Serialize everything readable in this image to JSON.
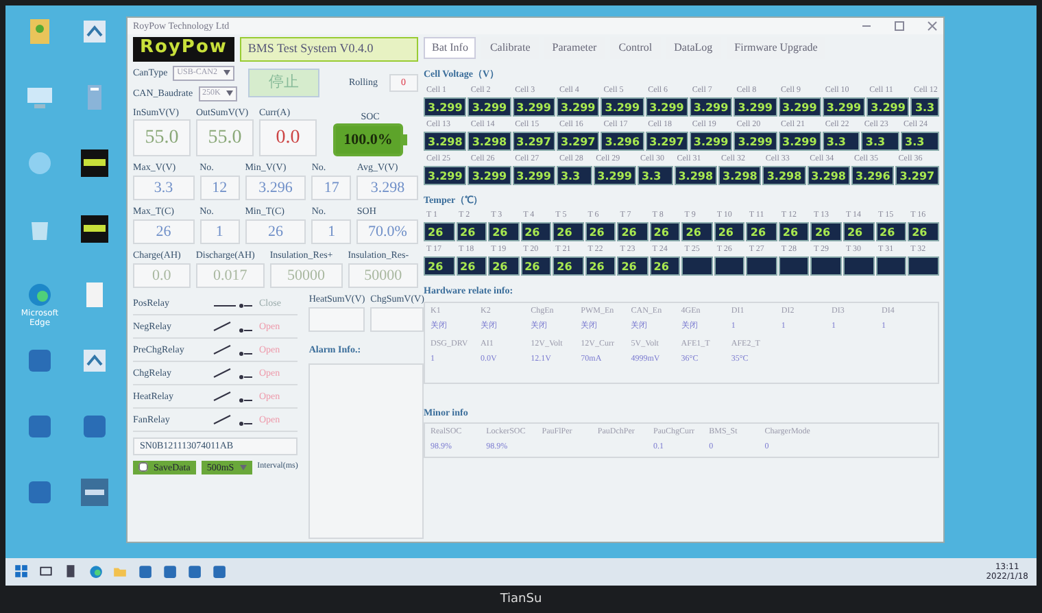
{
  "monitor": {
    "brand": "TianSu"
  },
  "desktop_icons": [
    {
      "kind": "user"
    },
    {
      "kind": "shortcut"
    },
    {
      "kind": "pc"
    },
    {
      "kind": "building"
    },
    {
      "kind": "network"
    },
    {
      "kind": "logo"
    },
    {
      "kind": "bin"
    },
    {
      "kind": "logo"
    },
    {
      "kind": "edge",
      "label": "Microsoft Edge"
    },
    {
      "kind": "doc"
    },
    {
      "kind": "app"
    },
    {
      "kind": "shortcut"
    },
    {
      "kind": "app"
    },
    {
      "kind": "app"
    },
    {
      "kind": "app"
    },
    {
      "kind": "bms"
    }
  ],
  "window": {
    "title": "RoyPow Technology Ltd",
    "logo": "RoyPow",
    "system_title": "BMS Test System V0.4.0"
  },
  "tabs": [
    {
      "label": "Bat Info",
      "selected": true
    },
    {
      "label": "Calibrate",
      "selected": false
    },
    {
      "label": "Parameter",
      "selected": false
    },
    {
      "label": "Control",
      "selected": false
    },
    {
      "label": "DataLog",
      "selected": false
    },
    {
      "label": "Firmware Upgrade",
      "selected": false
    }
  ],
  "connection": {
    "can_type_label": "CanType",
    "can_type": "USB-CAN2",
    "baud_label": "CAN_Baudrate",
    "baud": "250K",
    "stop_button": "停止",
    "rolling_label": "Rolling",
    "rolling": "0"
  },
  "summary": [
    {
      "label": "InSumV(V)",
      "value": "55.0",
      "kind": "voltage"
    },
    {
      "label": "OutSumV(V)",
      "value": "55.0",
      "kind": "voltage"
    },
    {
      "label": "Curr(A)",
      "value": "0.0",
      "kind": "current"
    }
  ],
  "soc": {
    "label": "SOC",
    "value": "100.0%",
    "level": 1.0
  },
  "stats": [
    [
      {
        "label": "Max_V(V)",
        "value": "3.3"
      },
      {
        "label": "No.",
        "value": "12"
      },
      {
        "label": "Min_V(V)",
        "value": "3.296"
      },
      {
        "label": "No.",
        "value": "17"
      },
      {
        "label": "Avg_V(V)",
        "value": "3.298"
      }
    ],
    [
      {
        "label": "Max_T(C)",
        "value": "26"
      },
      {
        "label": "No.",
        "value": "1"
      },
      {
        "label": "Min_T(C)",
        "value": "26"
      },
      {
        "label": "No.",
        "value": "1"
      },
      {
        "label": "SOH",
        "value": "70.0%"
      }
    ]
  ],
  "energy": [
    {
      "label": "Charge(AH)",
      "value": "0.0"
    },
    {
      "label": "Discharge(AH)",
      "value": "0.017"
    },
    {
      "label": "Insulation_Res+",
      "value": "50000"
    },
    {
      "label": "Insulation_Res-",
      "value": "50000"
    }
  ],
  "sums": [
    {
      "label": "HeatSumV(V)"
    },
    {
      "label": "ChgSumV(V)"
    }
  ],
  "relays": [
    {
      "name": "PosRelay",
      "closed": true,
      "state": "Close"
    },
    {
      "name": "NegRelay",
      "closed": false,
      "state": "Open"
    },
    {
      "name": "PreChgRelay",
      "closed": false,
      "state": "Open"
    },
    {
      "name": "ChgRelay",
      "closed": false,
      "state": "Open"
    },
    {
      "name": "HeatRelay",
      "closed": false,
      "state": "Open"
    },
    {
      "name": "FanRelay",
      "closed": false,
      "state": "Open"
    }
  ],
  "alarm": {
    "title": "Alarm Info.:"
  },
  "serial": "SN0B121113074011AB",
  "save": {
    "label": "SaveData",
    "checked": false,
    "interval": "500mS",
    "interval_label": "Interval(ms)"
  },
  "cell_voltage": {
    "title": "Cell Voltage（V）",
    "cells": [
      {
        "label": "Cell 1",
        "value": "3.299"
      },
      {
        "label": "Cell 2",
        "value": "3.299"
      },
      {
        "label": "Cell 3",
        "value": "3.299"
      },
      {
        "label": "Cell 4",
        "value": "3.299"
      },
      {
        "label": "Cell 5",
        "value": "3.299"
      },
      {
        "label": "Cell 6",
        "value": "3.299"
      },
      {
        "label": "Cell 7",
        "value": "3.299"
      },
      {
        "label": "Cell 8",
        "value": "3.299"
      },
      {
        "label": "Cell 9",
        "value": "3.299"
      },
      {
        "label": "Cell 10",
        "value": "3.299"
      },
      {
        "label": "Cell 11",
        "value": "3.299"
      },
      {
        "label": "Cell 12",
        "value": "3.3"
      },
      {
        "label": "Cell 13",
        "value": "3.298"
      },
      {
        "label": "Cell 14",
        "value": "3.298"
      },
      {
        "label": "Cell 15",
        "value": "3.297"
      },
      {
        "label": "Cell 16",
        "value": "3.297"
      },
      {
        "label": "Cell 17",
        "value": "3.296"
      },
      {
        "label": "Cell 18",
        "value": "3.297"
      },
      {
        "label": "Cell 19",
        "value": "3.299"
      },
      {
        "label": "Cell 20",
        "value": "3.299"
      },
      {
        "label": "Cell 21",
        "value": "3.299"
      },
      {
        "label": "Cell 22",
        "value": "3.3"
      },
      {
        "label": "Cell 23",
        "value": "3.3"
      },
      {
        "label": "Cell 24",
        "value": "3.3"
      },
      {
        "label": "Cell 25",
        "value": "3.299"
      },
      {
        "label": "Cell 26",
        "value": "3.299"
      },
      {
        "label": "Cell 27",
        "value": "3.299"
      },
      {
        "label": "Cell 28",
        "value": "3.3"
      },
      {
        "label": "Cell 29",
        "value": "3.299"
      },
      {
        "label": "Cell 30",
        "value": "3.3"
      },
      {
        "label": "Cell 31",
        "value": "3.298"
      },
      {
        "label": "Cell 32",
        "value": "3.298"
      },
      {
        "label": "Cell 33",
        "value": "3.298"
      },
      {
        "label": "Cell 34",
        "value": "3.298"
      },
      {
        "label": "Cell 35",
        "value": "3.296"
      },
      {
        "label": "Cell 36",
        "value": "3.297"
      }
    ]
  },
  "temperature": {
    "title": "Temper（℃）",
    "sensors": [
      {
        "label": "T 1",
        "value": "26"
      },
      {
        "label": "T 2",
        "value": "26"
      },
      {
        "label": "T 3",
        "value": "26"
      },
      {
        "label": "T 4",
        "value": "26"
      },
      {
        "label": "T 5",
        "value": "26"
      },
      {
        "label": "T 6",
        "value": "26"
      },
      {
        "label": "T 7",
        "value": "26"
      },
      {
        "label": "T 8",
        "value": "26"
      },
      {
        "label": "T 9",
        "value": "26"
      },
      {
        "label": "T 10",
        "value": "26"
      },
      {
        "label": "T 11",
        "value": "26"
      },
      {
        "label": "T 12",
        "value": "26"
      },
      {
        "label": "T 13",
        "value": "26"
      },
      {
        "label": "T 14",
        "value": "26"
      },
      {
        "label": "T 15",
        "value": "26"
      },
      {
        "label": "T 16",
        "value": "26"
      },
      {
        "label": "T 17",
        "value": "26"
      },
      {
        "label": "T 18",
        "value": "26"
      },
      {
        "label": "T 19",
        "value": "26"
      },
      {
        "label": "T 20",
        "value": "26"
      },
      {
        "label": "T 21",
        "value": "26"
      },
      {
        "label": "T 22",
        "value": "26"
      },
      {
        "label": "T 23",
        "value": "26"
      },
      {
        "label": "T 24",
        "value": "26"
      },
      {
        "label": "T 25"
      },
      {
        "label": "T 26"
      },
      {
        "label": "T 27"
      },
      {
        "label": "T 28"
      },
      {
        "label": "T 29"
      },
      {
        "label": "T 30"
      },
      {
        "label": "T 31"
      },
      {
        "label": "T 32"
      }
    ]
  },
  "hardware": {
    "title": "Hardware relate info:",
    "rows": [
      [
        {
          "label": "K1",
          "value": "关闭"
        },
        {
          "label": "K2",
          "value": "关闭"
        },
        {
          "label": "ChgEn",
          "value": "关闭"
        },
        {
          "label": "PWM_En",
          "value": "关闭"
        },
        {
          "label": "CAN_En",
          "value": "关闭"
        },
        {
          "label": "4GEn",
          "value": "关闭"
        },
        {
          "label": "DI1",
          "value": "1"
        },
        {
          "label": "DI2",
          "value": "1"
        },
        {
          "label": "DI3",
          "value": "1"
        },
        {
          "label": "DI4",
          "value": "1"
        }
      ],
      [
        {
          "label": "DSG_DRV",
          "value": "1"
        },
        {
          "label": "AI1",
          "value": "0.0V"
        },
        {
          "label": "12V_Volt",
          "value": "12.1V"
        },
        {
          "label": "12V_Curr",
          "value": "70mA"
        },
        {
          "label": "5V_Volt",
          "value": "4999mV"
        },
        {
          "label": "AFE1_T",
          "value": "36°C"
        },
        {
          "label": "AFE2_T",
          "value": "35°C"
        }
      ]
    ]
  },
  "minor": {
    "title": "Minor info",
    "items": [
      {
        "label": "RealSOC",
        "value": "98.9%"
      },
      {
        "label": "LockerSOC",
        "value": "98.9%"
      },
      {
        "label": "PauFlPer"
      },
      {
        "label": "PauDchPer"
      },
      {
        "label": "PauChgCurr",
        "value": "0.1"
      },
      {
        "label": "BMS_St",
        "value": "0"
      },
      {
        "label": "ChargerMode",
        "value": "0"
      }
    ]
  },
  "taskbar": {
    "icons": [
      {
        "kind": "start"
      },
      {
        "kind": "taskview"
      },
      {
        "kind": "calc"
      },
      {
        "kind": "edge"
      },
      {
        "kind": "folder"
      },
      {
        "kind": "app"
      },
      {
        "kind": "app"
      },
      {
        "kind": "app"
      },
      {
        "kind": "app"
      }
    ],
    "time": "13:11",
    "date": "2022/1/18"
  }
}
